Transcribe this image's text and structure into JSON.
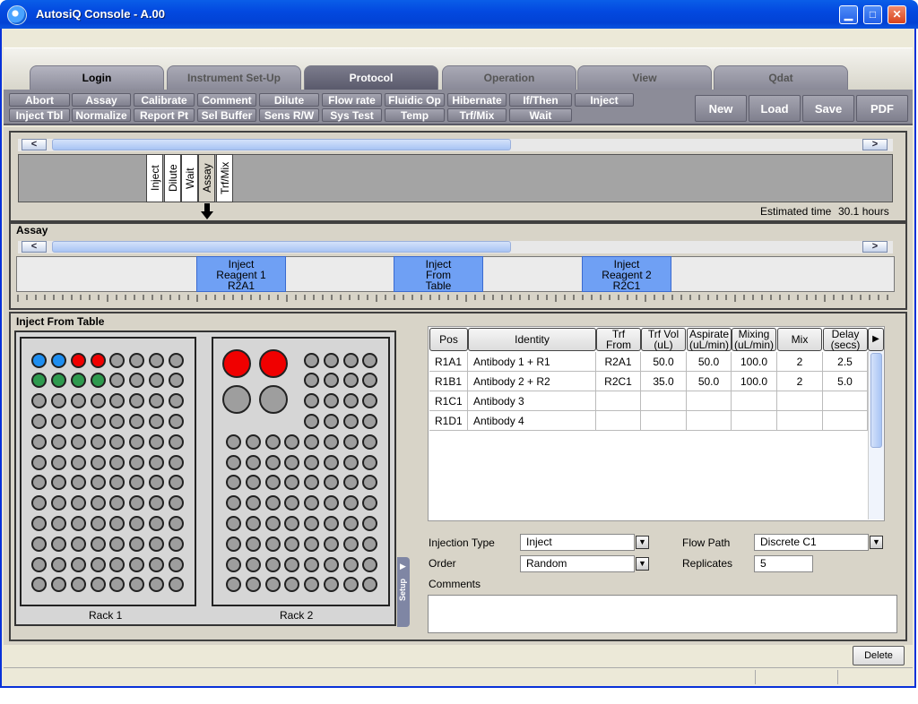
{
  "window": {
    "title": "AutosiQ Console - A.00",
    "minimize": "▁",
    "maximize": "□",
    "close": "✕"
  },
  "tabs": [
    "Login",
    "Instrument Set-Up",
    "Protocol",
    "Operation",
    "View",
    "Qdat"
  ],
  "commands_row1": [
    "Abort",
    "Assay",
    "Calibrate",
    "Comment",
    "Dilute",
    "Flow rate",
    "Fluidic Op",
    "Hibernate",
    "If/Then",
    "Inject"
  ],
  "commands_row2": [
    "Inject Tbl",
    "Normalize",
    "Report Pt",
    "Sel Buffer",
    "Sens R/W",
    "Sys Test",
    "Temp",
    "Trf/Mix",
    "Wait"
  ],
  "file_buttons": [
    "New",
    "Load",
    "Save",
    "PDF"
  ],
  "protocol": {
    "steps": [
      "Inject",
      "Dilute",
      "Wait",
      "Assay",
      "Trf/Mix"
    ],
    "selected_step": "Assay",
    "estimated_label": "Estimated time",
    "estimated_value": "30.1 hours",
    "scroll_left": "<",
    "scroll_right": ">"
  },
  "assay": {
    "title": "Assay",
    "blocks": [
      {
        "l1": "Inject",
        "l2": "Reagent 1",
        "l3": "R2A1"
      },
      {
        "l1": "Inject",
        "l2": "From",
        "l3": "Table"
      },
      {
        "l1": "Inject",
        "l2": "Reagent 2",
        "l3": "R2C1"
      }
    ]
  },
  "inject_table": {
    "title": "Inject From Table",
    "rack1_label": "Rack 1",
    "rack2_label": "Rack 2",
    "setup_label": "Setup",
    "columns": [
      {
        "l1": "Pos",
        "l2": ""
      },
      {
        "l1": "Identity",
        "l2": ""
      },
      {
        "l1": "Trf",
        "l2": "From"
      },
      {
        "l1": "Trf Vol",
        "l2": "(uL)"
      },
      {
        "l1": "Aspirate",
        "l2": "(uL/min)"
      },
      {
        "l1": "Mixing",
        "l2": "(uL/min)"
      },
      {
        "l1": "Mix",
        "l2": ""
      },
      {
        "l1": "Delay",
        "l2": "(secs)"
      }
    ],
    "rows": [
      [
        "R1A1",
        "Antibody 1 + R1",
        "R2A1",
        "50.0",
        "50.0",
        "100.0",
        "2",
        "2.5"
      ],
      [
        "R1B1",
        "Antibody 2 + R2",
        "R2C1",
        "35.0",
        "50.0",
        "100.0",
        "2",
        "5.0"
      ],
      [
        "R1C1",
        "Antibody 3",
        "",
        "",
        "",
        "",
        "",
        ""
      ],
      [
        "R1D1",
        "Antibody 4",
        "",
        "",
        "",
        "",
        "",
        ""
      ]
    ],
    "injection_type_label": "Injection Type",
    "injection_type_value": "Inject",
    "order_label": "Order",
    "order_value": "Random",
    "flow_path_label": "Flow Path",
    "flow_path_value": "Discrete C1",
    "replicates_label": "Replicates",
    "replicates_value": "5",
    "comments_label": "Comments",
    "comments_value": ""
  },
  "footer": {
    "delete_label": "Delete"
  },
  "colors": {
    "blue_well": "#1e8ef0",
    "red_well": "#f00000",
    "green_well": "#2e9a4e",
    "assay_block": "#6fa0f4"
  }
}
